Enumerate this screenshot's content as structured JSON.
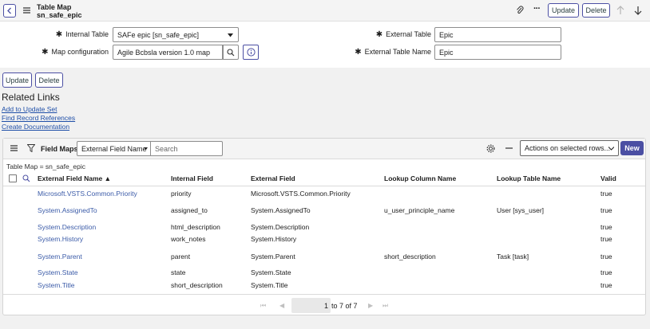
{
  "header": {
    "title": "Table Map",
    "subtitle": "sn_safe_epic",
    "update_label": "Update",
    "delete_label": "Delete"
  },
  "form": {
    "internal_table_label": "Internal Table",
    "internal_table_value": "SAFe epic [sn_safe_epic]",
    "map_configuration_label": "Map configuration",
    "map_configuration_value": "Agile Bcbsla version 1.0 map",
    "external_table_label": "External Table",
    "external_table_value": "Epic",
    "external_table_name_label": "External Table Name",
    "external_table_name_value": "Epic"
  },
  "actions": {
    "update_label": "Update",
    "delete_label": "Delete"
  },
  "related": {
    "heading": "Related Links",
    "links": [
      "Add to Update Set",
      "Find Record References",
      "Create Documentation"
    ]
  },
  "list": {
    "title": "Field Maps",
    "search_field_select": "External Field Name",
    "search_placeholder": "Search",
    "actions_select": "Actions on selected rows...",
    "new_label": "New",
    "breadcrumb": "Table Map = sn_safe_epic",
    "columns": [
      "External Field Name ▲",
      "Internal Field",
      "External Field",
      "Lookup Column Name",
      "Lookup Table Name",
      "Valid"
    ],
    "rows": [
      [
        "Microsoft.VSTS.Common.Priority",
        "priority",
        "Microsoft.VSTS.Common.Priority",
        "",
        "",
        "true"
      ],
      [
        "System.AssignedTo",
        "assigned_to",
        "System.AssignedTo",
        "u_user_principle_name",
        "User [sys_user]",
        "true"
      ],
      [
        "System.Description",
        "html_description",
        "System.Description",
        "",
        "",
        "true"
      ],
      [
        "System.History",
        "work_notes",
        "System.History",
        "",
        "",
        "true"
      ],
      [
        "System.Parent",
        "parent",
        "System.Parent",
        "short_description",
        "Task [task]",
        "true"
      ],
      [
        "System.State",
        "state",
        "System.State",
        "",
        "",
        "true"
      ],
      [
        "System.Title",
        "short_description",
        "System.Title",
        "",
        "",
        "true"
      ]
    ],
    "pagination": {
      "page_input": "1",
      "range_text": "to 7 of 7"
    }
  },
  "colors": {
    "accent": "#4b4fa3",
    "link": "#3b5ba8",
    "new_button": "#4b4fa3"
  }
}
